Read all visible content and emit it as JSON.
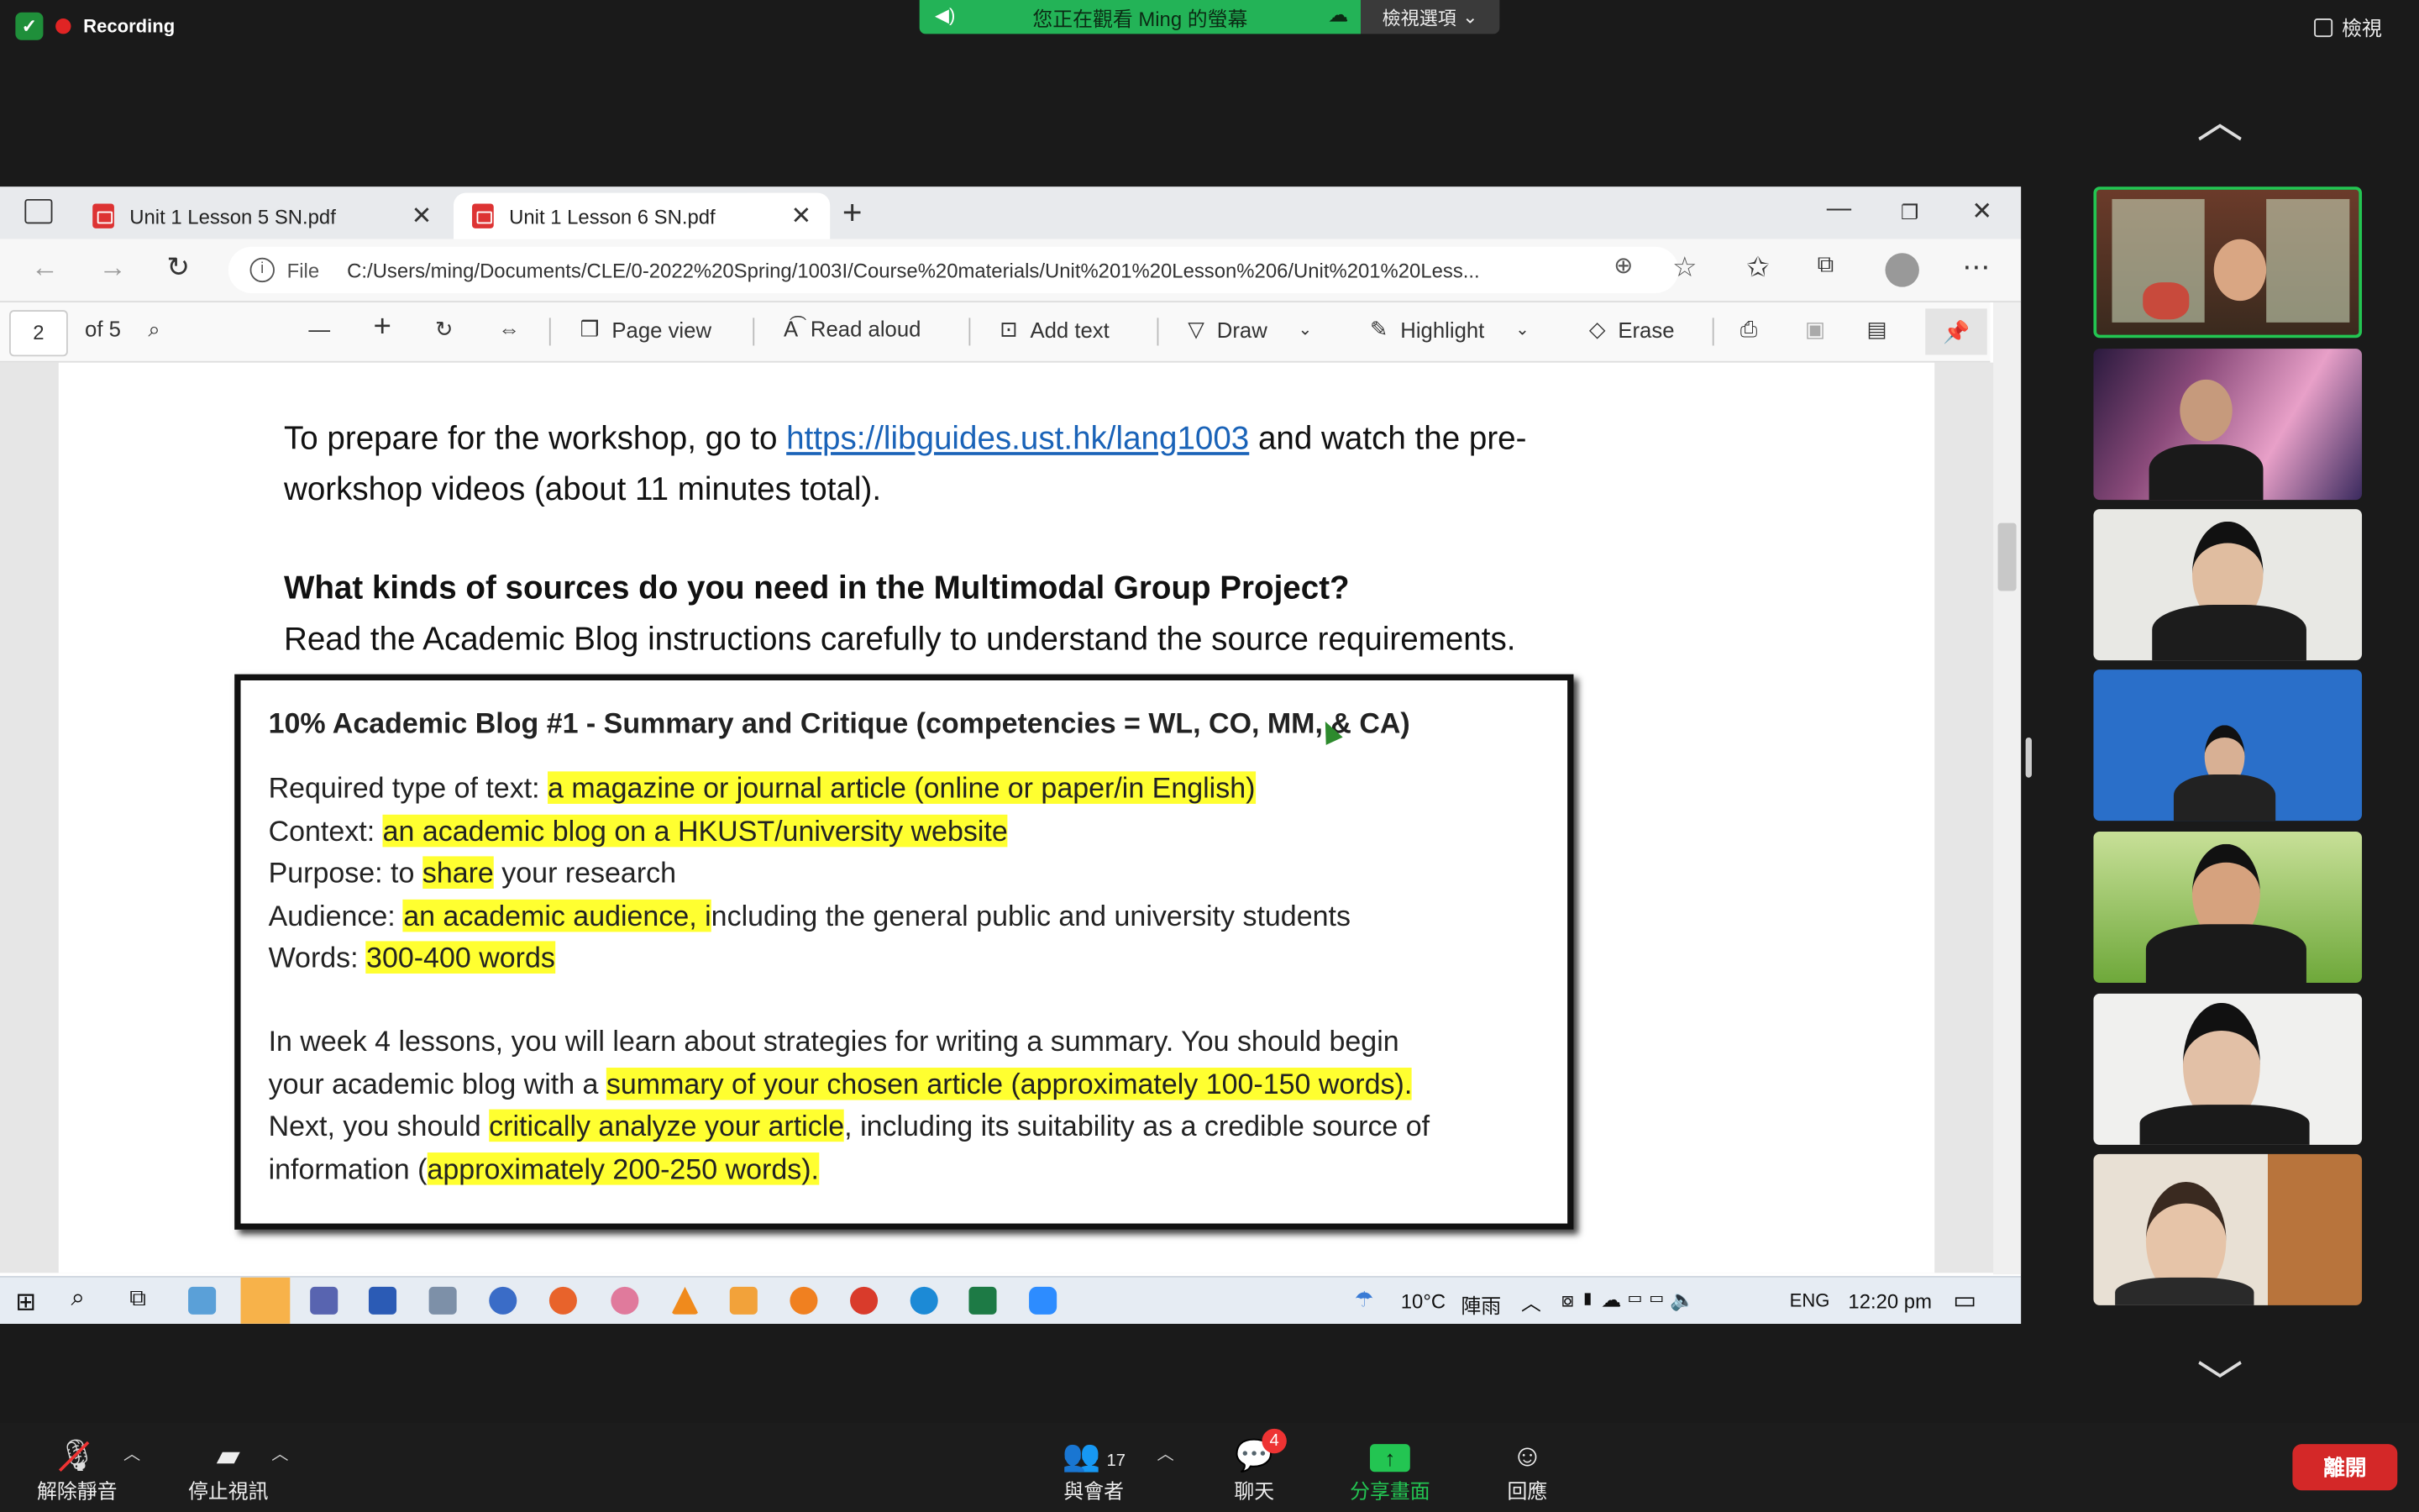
{
  "zoom": {
    "recording_label": "Recording",
    "viewing_banner": "您正在觀看 Ming 的螢幕",
    "view_options": "檢視選項",
    "view_button": "檢視"
  },
  "browser": {
    "tabs": [
      {
        "label": "Unit 1 Lesson 5 SN.pdf"
      },
      {
        "label": "Unit 1 Lesson 6 SN.pdf"
      }
    ],
    "file_label": "File",
    "url": "C:/Users/ming/Documents/CLE/0-2022%20Spring/1003I/Course%20materials/Unit%201%20Lesson%206/Unit%201%20Less..."
  },
  "pdf_toolbar": {
    "page": "2",
    "of_pages": "of 5",
    "page_view": "Page view",
    "read_aloud": "Read aloud",
    "add_text": "Add text",
    "draw": "Draw",
    "highlight": "Highlight",
    "erase": "Erase"
  },
  "document": {
    "intro_1": "To prepare for the workshop, go to ",
    "link": "https://libguides.ust.hk/lang1003",
    "intro_2": " and watch the pre-",
    "intro_3": "workshop videos (about 11 minutes total).",
    "heading": "What kinds of sources do you need in the Multimodal Group Project?",
    "subheading": "Read the Academic Blog instructions carefully to understand the source requirements.",
    "box": {
      "title": "10% Academic Blog #1 - Summary and Critique (competencies = WL, CO, MM, & CA)",
      "type_label": "Required type of text: ",
      "type_value": "a magazine or journal article (online or paper/in English)",
      "context_label": "Context: ",
      "context_value": "an academic blog on a HKUST/university website",
      "purpose_label": "Purpose: to ",
      "purpose_value": "share",
      "purpose_rest": " your research",
      "audience_label": "Audience: ",
      "audience_value": "an academic audience, i",
      "audience_rest": "ncluding the general public and university students",
      "words_label": "Words: ",
      "words_value": "300-400 words",
      "p2_a": "In week 4 lessons, you will learn about strategies for writing a summary.  You should begin",
      "p2_b": "your academic blog with a ",
      "p2_b_hl": "summary of your chosen article (approximately 100-150 words).",
      "p2_c": "Next, you should ",
      "p2_c_hl": "critically analyze your article",
      "p2_c_rest": ", including its suitability as a credible source of",
      "p2_d": "information (",
      "p2_d_hl": "approximately 200-250 words)."
    }
  },
  "taskbar": {
    "temperature": "10°C",
    "weather": "陣雨",
    "language": "ENG",
    "time": "12:20 pm"
  },
  "bottom_bar": {
    "unmute": "解除靜音",
    "stop_video": "停止視訊",
    "participants": "與會者",
    "participants_count": "17",
    "chat": "聊天",
    "chat_badge": "4",
    "share_screen": "分享畫面",
    "reactions": "回應",
    "leave": "離開"
  },
  "colors": {
    "zoom_green": "#23b357",
    "highlight_yellow": "#ffff30",
    "leave_red": "#d42828",
    "link_blue": "#1a63b8"
  }
}
